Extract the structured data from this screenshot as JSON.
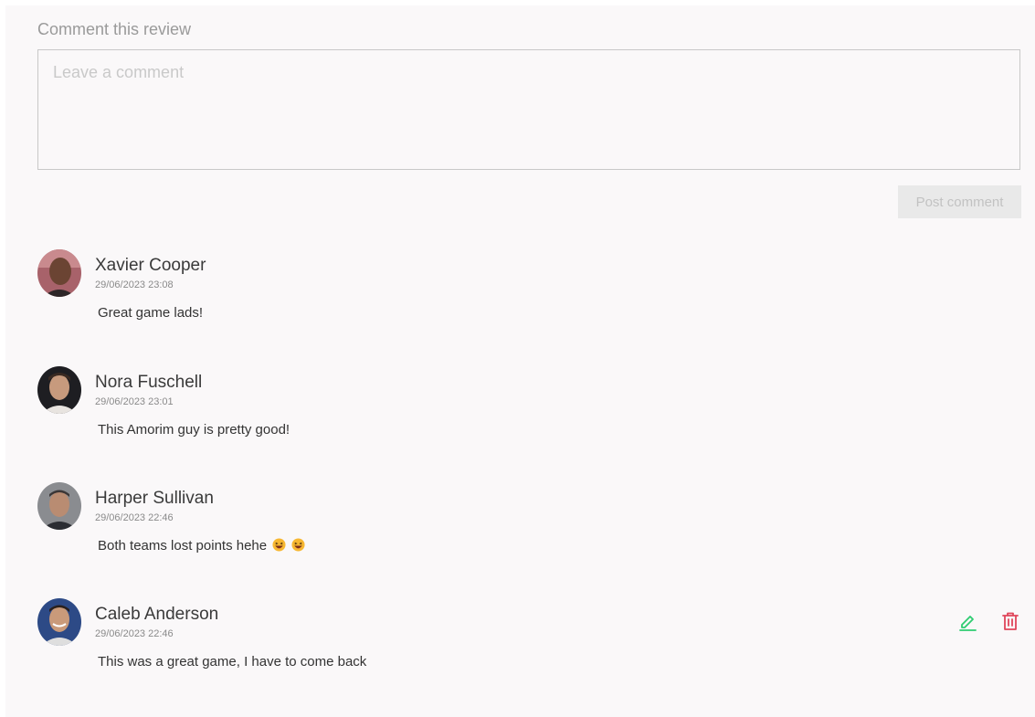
{
  "form": {
    "title": "Comment this review",
    "placeholder": "Leave a comment",
    "value": "",
    "post_label": "Post comment"
  },
  "comments": [
    {
      "author": "Xavier Cooper",
      "timestamp": "29/06/2023 23:08",
      "text": "Great game lads!"
    },
    {
      "author": "Nora Fuschell",
      "timestamp": "29/06/2023 23:01",
      "text": "This Amorim guy is pretty good!"
    },
    {
      "author": "Harper Sullivan",
      "timestamp": "29/06/2023 22:46",
      "text": "Both teams lost points hehe",
      "emojis": [
        "grinning-squinting-face-icon",
        "grinning-squinting-face-icon"
      ]
    },
    {
      "author": "Caleb Anderson",
      "timestamp": "29/06/2023 22:46",
      "text": "This was a great game, I have to come back",
      "actions": [
        "edit-icon",
        "delete-icon"
      ]
    }
  ],
  "colors": {
    "panel_background": "#faf8f9",
    "edit_icon": "#2ecc71",
    "delete_icon": "#e0455a",
    "button_background": "#e9e9e9",
    "button_text": "#c2c2c2"
  }
}
